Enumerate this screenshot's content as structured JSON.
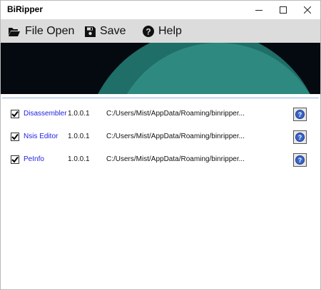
{
  "window": {
    "title": "BiRipper"
  },
  "toolbar": {
    "file_open_label": "File Open",
    "save_label": "Save",
    "help_label": "Help"
  },
  "plugins": [
    {
      "checked": true,
      "name": "Disassembler",
      "version": "1.0.0.1",
      "path": "C:/Users/Mist/AppData/Roaming/binripper..."
    },
    {
      "checked": true,
      "name": "Nsis Editor",
      "version": "1.0.0.1",
      "path": "C:/Users/Mist/AppData/Roaming/binripper..."
    },
    {
      "checked": true,
      "name": "PeInfo",
      "version": "1.0.0.1",
      "path": "C:/Users/Mist/AppData/Roaming/binripper..."
    }
  ],
  "colors": {
    "banner_bg": "#050a10",
    "banner_teal": "#2e8a80",
    "link_blue": "#1f1fe0",
    "toolbar_bg": "#dcdcdc"
  }
}
